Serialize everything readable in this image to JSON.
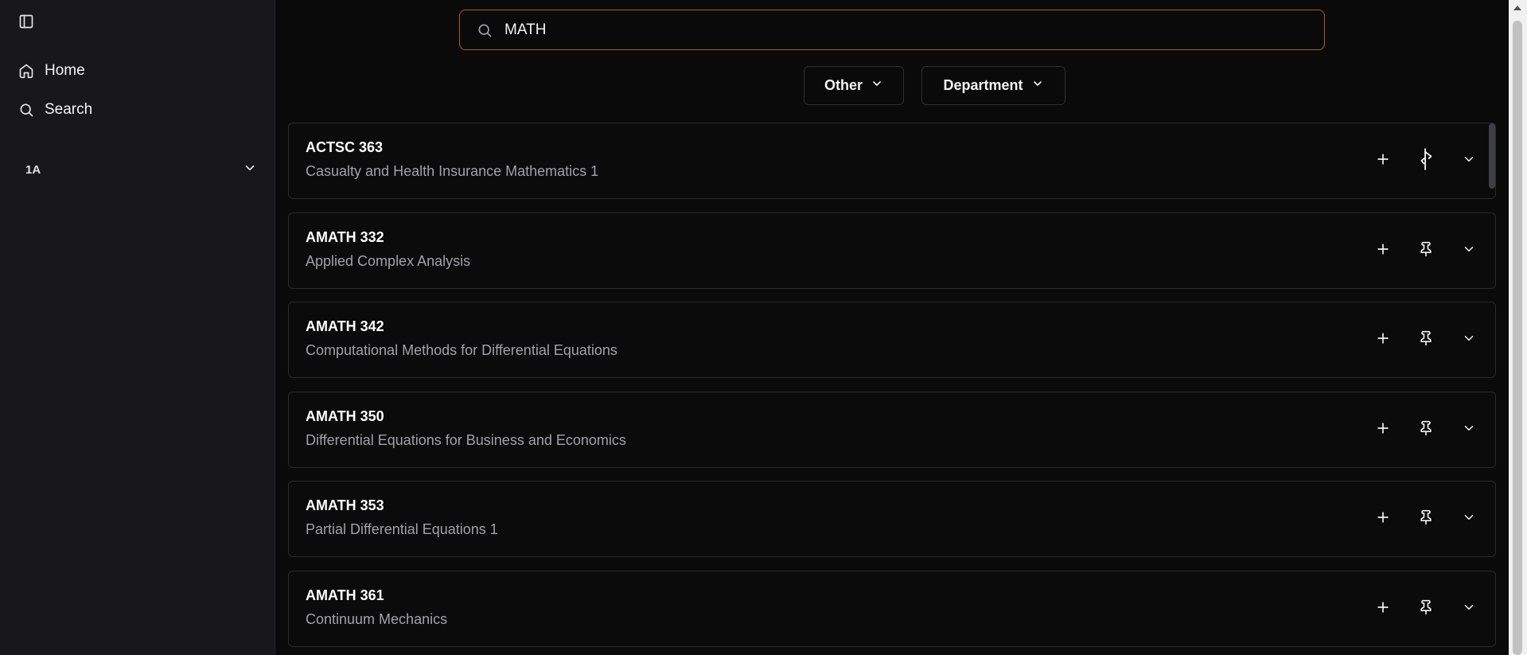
{
  "sidebar": {
    "nav": [
      {
        "label": "Home",
        "icon": "home-icon"
      },
      {
        "label": "Search",
        "icon": "search-icon"
      }
    ],
    "term": {
      "label": "1A",
      "icon": "chevron-down-icon"
    }
  },
  "search": {
    "value": "MATH",
    "placeholder": ""
  },
  "filters": {
    "other_label": "Other",
    "department_label": "Department"
  },
  "courses": [
    {
      "code": "ACTSC 363",
      "title": "Casualty and Health Insurance Mathematics 1"
    },
    {
      "code": "AMATH 332",
      "title": "Applied Complex Analysis"
    },
    {
      "code": "AMATH 342",
      "title": "Computational Methods for Differential Equations"
    },
    {
      "code": "AMATH 350",
      "title": "Differential Equations for Business and Economics"
    },
    {
      "code": "AMATH 353",
      "title": "Partial Differential Equations 1"
    },
    {
      "code": "AMATH 361",
      "title": "Continuum Mechanics"
    }
  ],
  "colors": {
    "accent_border": "#a16207",
    "sidebar_bg": "#18181b",
    "main_bg": "#0a0a0a"
  }
}
